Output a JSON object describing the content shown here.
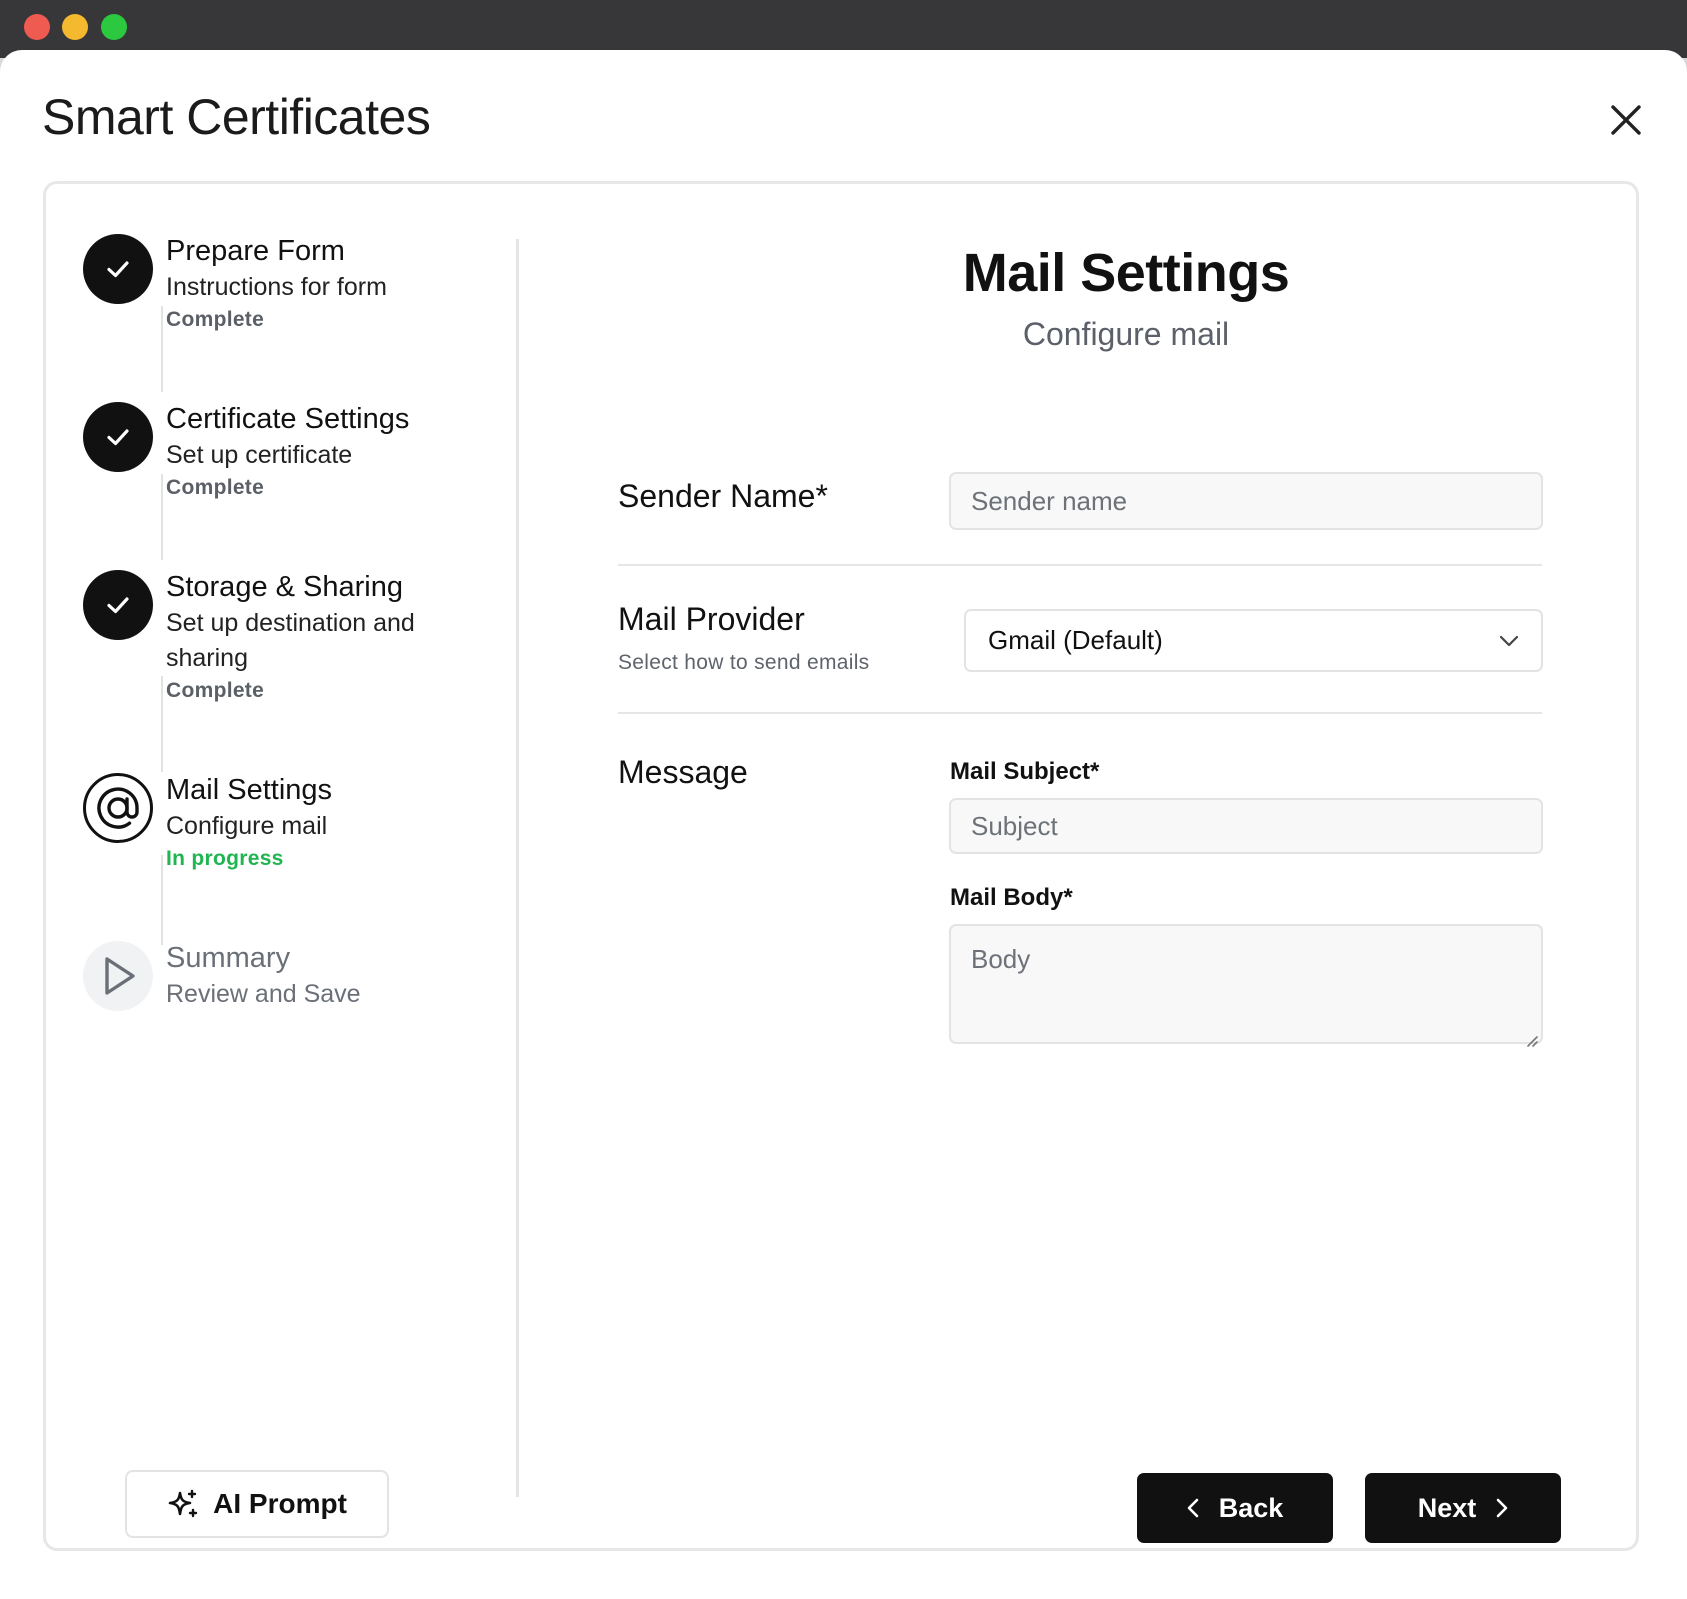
{
  "app": {
    "title": "Smart Certificates"
  },
  "steps": [
    {
      "title": "Prepare Form",
      "description": "Instructions for form",
      "status": "Complete",
      "state": "done",
      "icon": "check-icon"
    },
    {
      "title": "Certificate Settings",
      "description": "Set up certificate",
      "status": "Complete",
      "state": "done",
      "icon": "check-icon"
    },
    {
      "title": "Storage & Sharing",
      "description": "Set up destination and sharing",
      "status": "Complete",
      "state": "done",
      "icon": "check-icon"
    },
    {
      "title": "Mail Settings",
      "description": "Configure mail",
      "status": "In progress",
      "state": "current",
      "icon": "at-sign-icon"
    },
    {
      "title": "Summary",
      "description": "Review and Save",
      "status": "",
      "state": "pending",
      "icon": "play-icon"
    }
  ],
  "ai_prompt": {
    "label": "AI Prompt",
    "icon": "sparkle-icon"
  },
  "main": {
    "title": "Mail Settings",
    "subtitle": "Configure mail",
    "sender": {
      "label": "Sender Name*",
      "placeholder": "Sender name",
      "value": ""
    },
    "provider": {
      "label": "Mail Provider",
      "hint": "Select how to send emails",
      "selected": "Gmail (Default)"
    },
    "message": {
      "label": "Message",
      "subject_label": "Mail Subject*",
      "subject_placeholder": "Subject",
      "body_label": "Mail Body*",
      "body_placeholder": "Body"
    }
  },
  "nav": {
    "back_label": "Back",
    "next_label": "Next"
  },
  "colors": {
    "accent": "#111111",
    "in_progress": "#1fb551",
    "muted": "#5b5f66"
  }
}
